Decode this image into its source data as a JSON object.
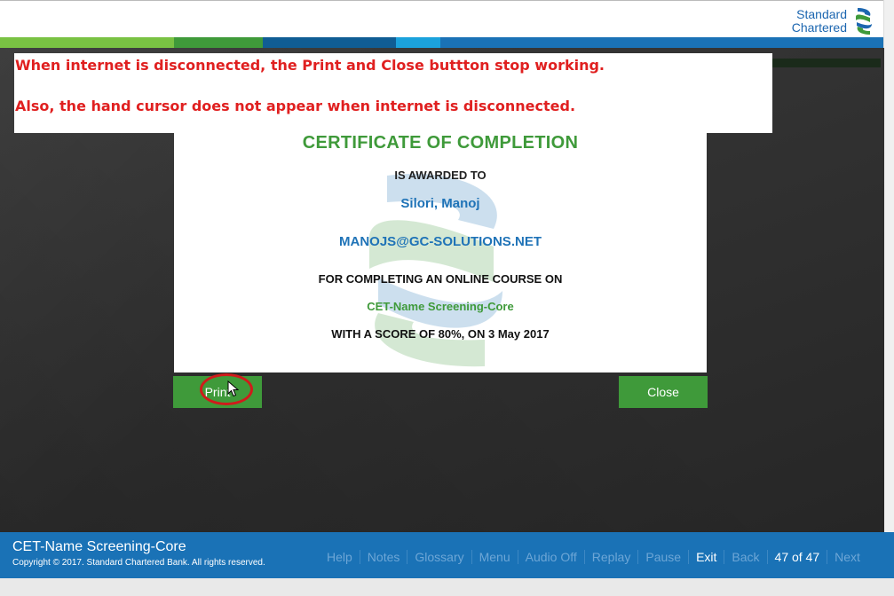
{
  "header": {
    "brand_line1": "Standard",
    "brand_line2": "Chartered"
  },
  "colorbar": [
    "#79c243",
    "#3f9a3a",
    "#105d94",
    "#1a72b6",
    "#1ba2dc",
    "#1a72b6"
  ],
  "annotation": {
    "line1": "When internet is disconnected, the Print and Close buttton stop working.",
    "line2": "Also, the hand cursor does not appear when internet is disconnected."
  },
  "certificate": {
    "title": "CERTIFICATE OF COMPLETION",
    "awarded_to": "IS AWARDED TO",
    "name": "Silori, Manoj",
    "email": "MANOJS@GC-SOLUTIONS.NET",
    "completing": "FOR COMPLETING AN ONLINE COURSE ON",
    "course": "CET-Name Screening-Core",
    "score": "WITH A SCORE OF 80%, ON 3 May 2017"
  },
  "buttons": {
    "print": "Print",
    "close": "Close"
  },
  "footer": {
    "course_title": "CET-Name Screening-Core",
    "copyright": "Copyright © 2017. Standard Chartered Bank. All rights reserved.",
    "nav": {
      "help": "Help",
      "notes": "Notes",
      "glossary": "Glossary",
      "menu": "Menu",
      "audio": "Audio Off",
      "replay": "Replay",
      "pause": "Pause",
      "exit": "Exit",
      "back": "Back",
      "page": "47 of 47",
      "next": "Next"
    }
  },
  "colors": {
    "accent_green": "#3f9a3a",
    "accent_blue": "#1a72b6",
    "annotation_red": "#e02020"
  }
}
